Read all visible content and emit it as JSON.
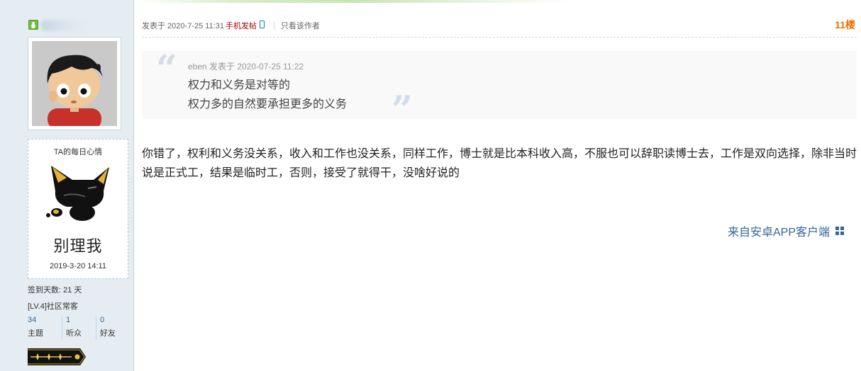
{
  "author": {
    "mood_title": "TA的每日心情",
    "mood_text": "别理我",
    "mood_date": "2019-3-20 14:11",
    "signin_label": "签到天数: 21 天",
    "level": "[LV.4]社区常客",
    "stats": [
      {
        "num": "34",
        "label": "主题"
      },
      {
        "num": "1",
        "label": "听众"
      },
      {
        "num": "0",
        "label": "好友"
      }
    ]
  },
  "post": {
    "posted_prefix": "发表于 2020-7-25 11:31",
    "posted_via": "手机发帖",
    "only_author": "只看该作者",
    "floor": "11楼",
    "quote": {
      "author_line": "eben 发表于 2020-07-25 11:22",
      "lines": [
        "权力和义务是对等的",
        "权力多的自然要承担更多的义务"
      ]
    },
    "body": "你错了，权利和义务没关系，收入和工作也没关系，同样工作，博士就是比本科收入高，不服也可以辞职读博士去，工作是双向选择，除非当时说是正式工，结果是临时工，否则，接受了就得干，没啥好说的",
    "from_app": "来自安卓APP客户端"
  },
  "colors": {
    "floor": "#f26c00",
    "link": "#336699",
    "app_red": "#aa0000"
  }
}
